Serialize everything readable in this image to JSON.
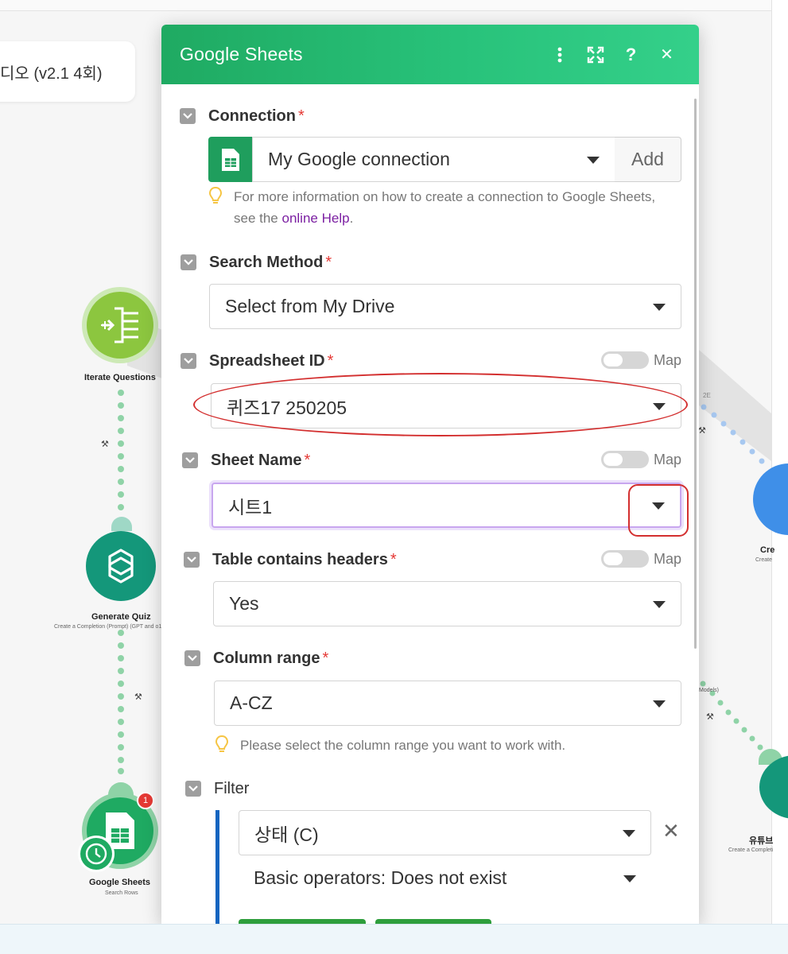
{
  "canvas": {
    "scenario_title": "디오 (v2.1 4회)",
    "nodes": [
      {
        "name": "Iterate Questions",
        "sub": ""
      },
      {
        "name": "Generate Quiz",
        "sub": "Create a Completion (Prompt) (GPT and o1,"
      },
      {
        "name": "Google Sheets",
        "sub": "Search Rows",
        "badge": "1"
      },
      {
        "name": "Cre",
        "sub": "Create"
      },
      {
        "name": "유튜브",
        "sub": "Create a Completi"
      }
    ],
    "edge_tags": [
      "2E",
      "Models)"
    ]
  },
  "panel": {
    "title": "Google Sheets",
    "header_icons": [
      "more-vertical-icon",
      "expand-icon",
      "help-icon",
      "close-icon"
    ],
    "header_glyphs": {
      "more": "⋮",
      "expand": "⛶",
      "help": "?",
      "close": "✕"
    },
    "fields": {
      "connection": {
        "label": "Connection",
        "required": "*",
        "value": "My Google connection",
        "add_label": "Add",
        "hint_pre": "For more information on how to create a connection to Google Sheets, see the ",
        "hint_link": "online Help",
        "hint_post": "."
      },
      "search_method": {
        "label": "Search Method",
        "required": "*",
        "value": "Select from My Drive"
      },
      "spreadsheet_id": {
        "label": "Spreadsheet ID",
        "required": "*",
        "map": "Map",
        "value": "퀴즈17 250205"
      },
      "sheet_name": {
        "label": "Sheet Name",
        "required": "*",
        "map": "Map",
        "value": "시트1"
      },
      "table_headers": {
        "label": "Table contains headers",
        "required": "*",
        "map": "Map",
        "value": "Yes"
      },
      "column_range": {
        "label": "Column range",
        "required": "*",
        "value": "A-CZ",
        "hint": "Please select the column range you want to work with."
      },
      "filter": {
        "label": "Filter",
        "column": "상태 (C)",
        "operator": "Basic operators: Does not exist",
        "remove": "✕"
      }
    }
  },
  "colors": {
    "header_green": "#1faa62",
    "accent_green": "#2e9e3c",
    "annotation_red": "#d32f2f",
    "filter_blue": "#1565c0"
  }
}
